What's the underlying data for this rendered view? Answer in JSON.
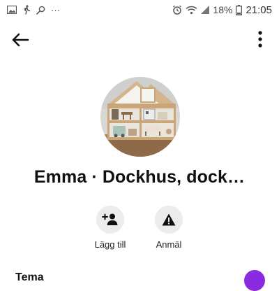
{
  "status_bar": {
    "battery": "18%",
    "time": "21:05",
    "ellipsis": "···"
  },
  "profile": {
    "name": "Emma · Dockhus, dock…"
  },
  "actions": [
    {
      "label": "Lägg till",
      "icon": "add-person-icon"
    },
    {
      "label": "Anmäl",
      "icon": "warning-icon"
    }
  ],
  "section": {
    "title": "Tema",
    "accent_color": "#8a2be2"
  }
}
